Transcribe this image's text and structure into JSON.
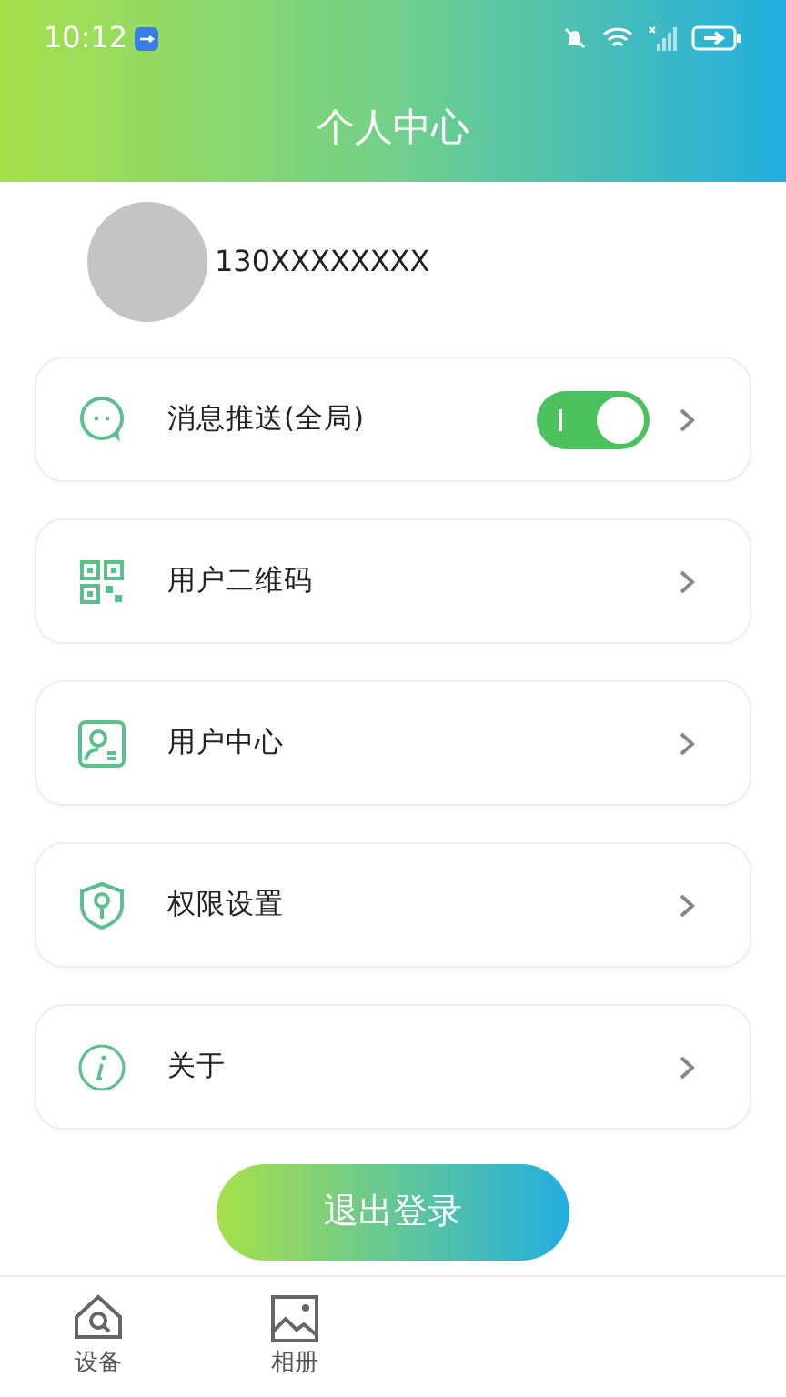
{
  "status_bar": {
    "time": "10:12"
  },
  "header": {
    "title": "个人中心"
  },
  "profile": {
    "phone": "130XXXXXXXX"
  },
  "menu": [
    {
      "kind": "toggle",
      "label": "消息推送(全局)",
      "on": true
    },
    {
      "kind": "plain",
      "label": "用户二维码"
    },
    {
      "kind": "plain",
      "label": "用户中心"
    },
    {
      "kind": "plain",
      "label": "权限设置"
    },
    {
      "kind": "plain",
      "label": "关于"
    }
  ],
  "logout_button": "退出登录",
  "bottom_nav": [
    {
      "label": "设备"
    },
    {
      "label": "相册"
    }
  ]
}
